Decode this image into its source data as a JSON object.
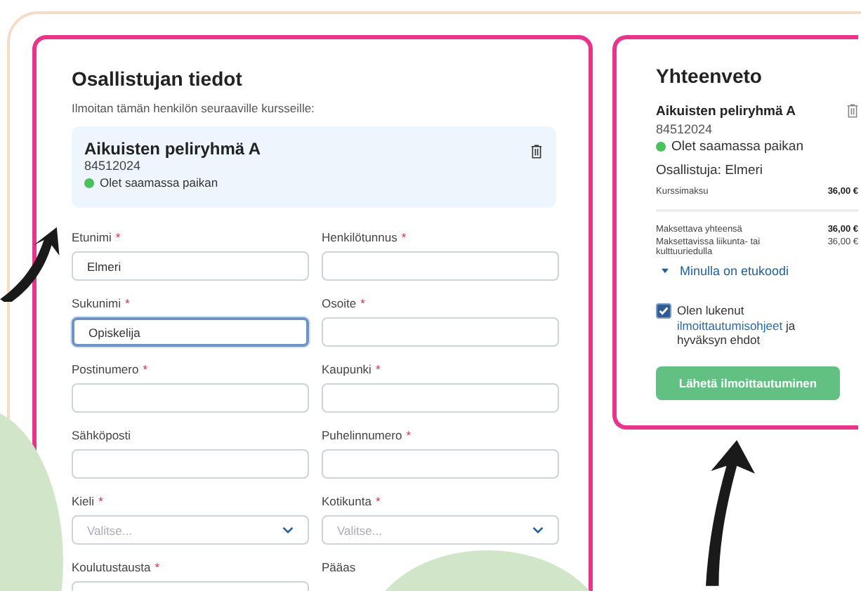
{
  "participant_form": {
    "title": "Osallistujan tiedot",
    "intro": "Ilmoitan tämän henkilön seuraaville kursseille:",
    "course": {
      "name": "Aikuisten peliryhmä A",
      "code": "84512024",
      "status": "Olet saamassa paikan"
    },
    "required_mark": "*",
    "fields": [
      {
        "label": "Etunimi",
        "required": true,
        "kind": "text",
        "value": "Elmeri",
        "focused": false
      },
      {
        "label": "Henkilötunnus",
        "required": true,
        "kind": "text",
        "focused": false
      },
      {
        "label": "Sukunimi",
        "required": true,
        "kind": "text",
        "value": "Opiskelija",
        "focused": true
      },
      {
        "label": "Osoite",
        "required": true,
        "kind": "text",
        "focused": false
      },
      {
        "label": "Postinumero",
        "required": true,
        "kind": "text",
        "focused": false
      },
      {
        "label": "Kaupunki",
        "required": true,
        "kind": "text",
        "focused": false
      },
      {
        "label": "Sähköposti",
        "required": false,
        "kind": "text",
        "focused": false
      },
      {
        "label": "Puhelinnumero",
        "required": true,
        "kind": "text",
        "focused": false
      },
      {
        "label": "Kieli",
        "required": true,
        "kind": "select",
        "placeholder": "Valitse...",
        "focused": false
      },
      {
        "label": "Kotikunta",
        "required": true,
        "kind": "select",
        "placeholder": "Valitse...",
        "focused": false
      },
      {
        "label": "Koulutustausta",
        "required": true,
        "kind": "text",
        "focused": false
      },
      {
        "label": "Pääas",
        "required": false,
        "kind": "label",
        "focused": false
      }
    ]
  },
  "summary": {
    "title": "Yhteenveto",
    "course": {
      "name": "Aikuisten peliryhmä A",
      "code": "84512024",
      "status": "Olet saamassa paikan"
    },
    "participant": "Osallistuja: Elmeri",
    "fee_rows": [
      {
        "label": "Kurssimaksu",
        "amount": "36,00 €",
        "bold": true
      }
    ],
    "totals": [
      {
        "label": "Maksettava yhteensä",
        "amount": "36,00 €",
        "bold": true
      },
      {
        "label": "Maksettavissa liikunta- tai kulttuuriedulla",
        "amount": "36,00 €",
        "bold": false
      }
    ],
    "discount_toggle": {
      "label": "Minulla on etukoodi",
      "expanded": false
    },
    "consent": {
      "checked": true,
      "before": "Olen lukenut",
      "link": "ilmoittautumisohjeet",
      "after": "ja hyväksyn ehdot"
    },
    "submit": "Lähetä ilmoittautuminen"
  }
}
